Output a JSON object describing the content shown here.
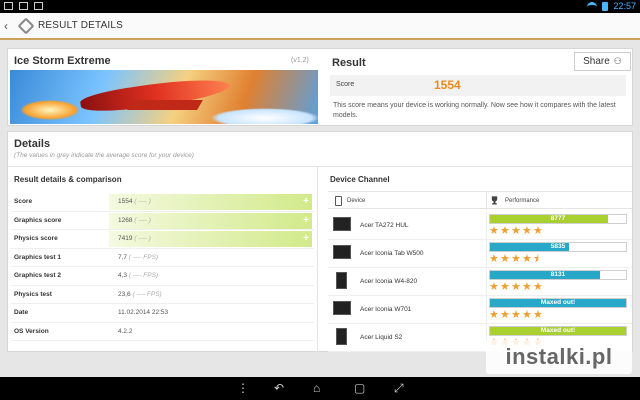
{
  "status": {
    "time": "22:57"
  },
  "actionbar": {
    "title": "RESULT DETAILS"
  },
  "test": {
    "name": "Ice Storm Extreme",
    "version": "(v1.2)"
  },
  "result": {
    "title": "Result",
    "share_label": "Share",
    "score_label": "Score",
    "score_value": "1554",
    "description": "This score means your device is working normally. Now see how it compares with the latest models."
  },
  "details": {
    "title": "Details",
    "subtitle": "(The values in grey indicate the average score for your device)",
    "results_header": "Result details & comparison",
    "rows": [
      {
        "label": "Score",
        "value": "1554",
        "avg": "( ---- )",
        "highlight": true
      },
      {
        "label": "Graphics score",
        "value": "1268",
        "avg": "( ---- )",
        "highlight": true
      },
      {
        "label": "Physics score",
        "value": "7419",
        "avg": "( ---- )",
        "highlight": true
      },
      {
        "label": "Graphics test 1",
        "value": "7,7",
        "avg": "( ---- FPS)",
        "highlight": false
      },
      {
        "label": "Graphics test 2",
        "value": "4,3",
        "avg": "( ---- FPS)",
        "highlight": false
      },
      {
        "label": "Physics test",
        "value": "23,6",
        "avg": "( ---- FPS)",
        "highlight": false
      },
      {
        "label": "Date",
        "value": "11.02.2014 22:53",
        "avg": "",
        "highlight": false
      },
      {
        "label": "OS Version",
        "value": "4.2.2",
        "avg": "",
        "highlight": false
      }
    ]
  },
  "device_channel": {
    "title": "Device Channel",
    "col_device": "Device",
    "col_performance": "Performance",
    "devices": [
      {
        "name": "Acer TA272 HUL",
        "score_text": "8777",
        "fill": 0.87,
        "color": "#a8d030",
        "stars": 5
      },
      {
        "name": "Acer Iconia Tab W500",
        "score_text": "5835",
        "fill": 0.58,
        "color": "#28a8c8",
        "stars": 4.5
      },
      {
        "name": "Acer Iconia W4-820",
        "score_text": "8131",
        "fill": 0.81,
        "color": "#28a8c8",
        "stars": 5
      },
      {
        "name": "Acer Iconia W701",
        "score_text": "Maxed out!",
        "fill": 1.0,
        "color": "#28a8c8",
        "stars": 5
      },
      {
        "name": "Acer Liquid S2",
        "score_text": "Maxed out!",
        "fill": 1.0,
        "color": "#a8d030",
        "stars": 5
      }
    ]
  },
  "watermark": "instalki.pl"
}
